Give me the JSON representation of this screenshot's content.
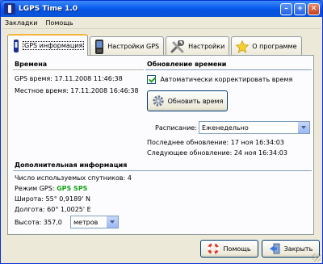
{
  "window": {
    "title": "LGPS Time 1.0"
  },
  "menu": {
    "items": [
      "Закладки",
      "Помощь"
    ]
  },
  "tabs": [
    {
      "label": "GPS информация",
      "icon": "gps-device-icon",
      "active": true
    },
    {
      "label": "Настройки GPS",
      "icon": "phone-icon",
      "active": false
    },
    {
      "label": "Настройки",
      "icon": "tools-icon",
      "active": false
    },
    {
      "label": "О программе",
      "icon": "star-icon",
      "active": false
    }
  ],
  "times": {
    "title": "Времена",
    "gps_time_label": "GPS время:",
    "gps_time_value": "17.11.2008 11:46:38",
    "local_time_label": "Местное время:",
    "local_time_value": "17.11.2008 16:46:38"
  },
  "update": {
    "title": "Обновление времени",
    "auto_correct_label": "Автоматически корректировать время",
    "auto_correct_checked": true,
    "update_button_label": "Обновить время",
    "schedule_label": "Расписание:",
    "schedule_value": "Еженедельно",
    "last_update_label": "Последнее обновление:",
    "last_update_value": "17 ноя 16:34:03",
    "next_update_label": "Следующее обновление:",
    "next_update_value": "24 ноя 16:34:03"
  },
  "extra": {
    "title": "Дополнительная информация",
    "satellites_label": "Число используемых спутников:",
    "satellites_value": "4",
    "gps_mode_label": "Режим GPS:",
    "gps_mode_value": "GPS SPS",
    "latitude_label": "Широта:",
    "latitude_value": "55° 0,9189' N",
    "longitude_label": "Долгота:",
    "longitude_value": "60° 1,0025' E",
    "altitude_label": "Высота:",
    "altitude_value": "357,0",
    "altitude_unit": "метров"
  },
  "footer": {
    "help_label": "Помощь",
    "close_label": "Закрыть"
  },
  "colors": {
    "gps_mode": "#1aa31a",
    "title_bar": "#0a5ef0",
    "active_tab": "#f5b53a"
  }
}
